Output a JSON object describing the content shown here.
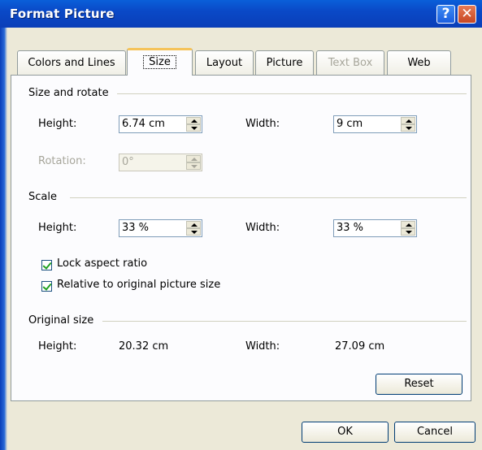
{
  "window": {
    "title": "Format Picture",
    "help_glyph": "?",
    "close_glyph": "✕"
  },
  "tabs": [
    {
      "label": "Colors and Lines",
      "state": "normal"
    },
    {
      "label": "Size",
      "state": "active"
    },
    {
      "label": "Layout",
      "state": "normal"
    },
    {
      "label": "Picture",
      "state": "normal"
    },
    {
      "label": "Text Box",
      "state": "disabled"
    },
    {
      "label": "Web",
      "state": "normal"
    }
  ],
  "size_rotate": {
    "heading": "Size and rotate",
    "height_label": "Height:",
    "height_value": "6.74 cm",
    "width_label": "Width:",
    "width_value": "9 cm",
    "rotation_label": "Rotation:",
    "rotation_value": "0°"
  },
  "scale": {
    "heading": "Scale",
    "height_label": "Height:",
    "height_value": "33 %",
    "width_label": "Width:",
    "width_value": "33 %",
    "lock_aspect_label": "Lock aspect ratio",
    "lock_aspect_checked": true,
    "relative_label": "Relative to original picture size",
    "relative_checked": true
  },
  "original_size": {
    "heading": "Original size",
    "height_label": "Height:",
    "height_value": "20.32 cm",
    "width_label": "Width:",
    "width_value": "27.09 cm"
  },
  "buttons": {
    "reset": "Reset",
    "ok": "OK",
    "cancel": "Cancel"
  }
}
